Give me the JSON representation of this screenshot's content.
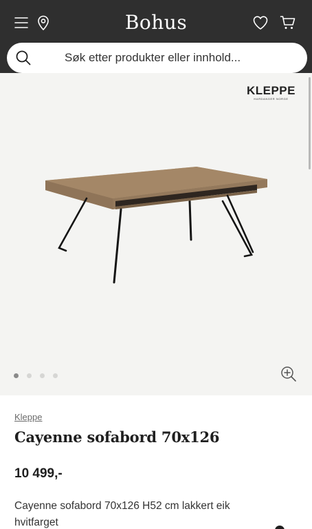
{
  "header": {
    "logo": "Bohus",
    "menu_icon": "menu-icon",
    "location_icon": "location-pin-icon",
    "wishlist_icon": "heart-icon",
    "cart_icon": "cart-icon",
    "background": "#2f2f2f"
  },
  "search": {
    "placeholder": "Søk etter produkter eller innhold..."
  },
  "gallery": {
    "brand_logo": "KLEPPE",
    "brand_logo_sub": "HARDANGER NORGE",
    "image_count": 4,
    "active_index": 0
  },
  "product": {
    "brand": "Kleppe",
    "title": "Cayenne sofabord 70x126",
    "price": "10 499,-",
    "description": "Cayenne sofabord 70x126 H52 cm lakkert eik hvitfarget"
  }
}
